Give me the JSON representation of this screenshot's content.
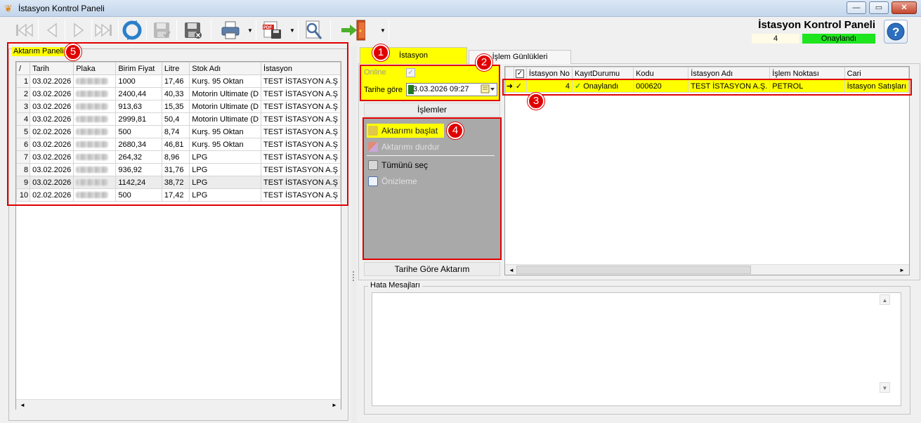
{
  "window": {
    "title": "İstasyon Kontrol Paneli",
    "buttons": {
      "minimize": "—",
      "maximize": "▭",
      "close": "✕"
    }
  },
  "header": {
    "title": "İstasyon Kontrol Paneli",
    "count": "4",
    "status": "Onaylandı",
    "status_color": "#1ee51e"
  },
  "toolbar": {
    "icons": [
      "first-record-icon",
      "previous-record-icon",
      "next-record-icon",
      "last-record-icon",
      "refresh-icon",
      "save-icon",
      "cancel-save-icon",
      "print-icon",
      "export-pdf-icon",
      "tools-icon",
      "exit-icon"
    ],
    "dropdown_glyph": "▼"
  },
  "left_panel": {
    "legend": "Aktarım Paneli",
    "columns": [
      "/",
      "Tarih",
      "Plaka",
      "Birim Fiyat",
      "Litre",
      "Stok Adı",
      "İstasyon"
    ],
    "rows": [
      {
        "no": "1",
        "tarih": "03.02.2026",
        "birim_fiyat": "1000",
        "litre": "17,46",
        "stok": "Kurş. 95 Oktan",
        "istasyon": "TEST İSTASYON A.Ş"
      },
      {
        "no": "2",
        "tarih": "03.02.2026",
        "birim_fiyat": "2400,44",
        "litre": "40,33",
        "stok": "Motorin Ultimate (D",
        "istasyon": "TEST İSTASYON A.Ş"
      },
      {
        "no": "3",
        "tarih": "03.02.2026",
        "birim_fiyat": "913,63",
        "litre": "15,35",
        "stok": "Motorin Ultimate (D",
        "istasyon": "TEST İSTASYON A.Ş"
      },
      {
        "no": "4",
        "tarih": "03.02.2026",
        "birim_fiyat": "2999,81",
        "litre": "50,4",
        "stok": "Motorin Ultimate (D",
        "istasyon": "TEST İSTASYON A.Ş"
      },
      {
        "no": "5",
        "tarih": "02.02.2026",
        "birim_fiyat": "500",
        "litre": "8,74",
        "stok": "Kurş. 95 Oktan",
        "istasyon": "TEST İSTASYON A.Ş"
      },
      {
        "no": "6",
        "tarih": "03.02.2026",
        "birim_fiyat": "2680,34",
        "litre": "46,81",
        "stok": "Kurş. 95 Oktan",
        "istasyon": "TEST İSTASYON A.Ş"
      },
      {
        "no": "7",
        "tarih": "03.02.2026",
        "birim_fiyat": "264,32",
        "litre": "8,96",
        "stok": "LPG",
        "istasyon": "TEST İSTASYON A.Ş"
      },
      {
        "no": "8",
        "tarih": "03.02.2026",
        "birim_fiyat": "936,92",
        "litre": "31,76",
        "stok": "LPG",
        "istasyon": "TEST İSTASYON A.Ş"
      },
      {
        "no": "9",
        "tarih": "03.02.2026",
        "birim_fiyat": "1142,24",
        "litre": "38,72",
        "stok": "LPG",
        "istasyon": "TEST İSTASYON A.Ş"
      },
      {
        "no": "10",
        "tarih": "02.02.2026",
        "birim_fiyat": "500",
        "litre": "17,42",
        "stok": "LPG",
        "istasyon": "TEST İSTASYON A.Ş"
      }
    ]
  },
  "tabs": [
    {
      "label": "İstasyon"
    },
    {
      "label": "İşlem Günlükleri"
    }
  ],
  "filters": {
    "online_label": "Online",
    "online_checked": "✓",
    "date_label": "Tarihe göre",
    "date_value": "3.03.2026 09:27"
  },
  "operations": {
    "title": "İşlemler",
    "items": [
      {
        "label": "Aktarımı başlat",
        "icon": "start-transfer-icon"
      },
      {
        "label": "Aktarımı durdur",
        "icon": "stop-transfer-icon"
      },
      {
        "label": "Tümünü seç",
        "icon": "select-all-icon"
      },
      {
        "label": "Önizleme",
        "icon": "preview-icon"
      }
    ],
    "footer": "Tarihe Göre Aktarım"
  },
  "right_grid": {
    "columns": [
      "",
      "✓",
      "İstasyon No",
      "KayıtDurumu",
      "Kodu",
      "İstasyon Adı",
      "İşlem Noktası",
      "Cari"
    ],
    "row": {
      "indicator": "➜",
      "checked": "✓",
      "istasyon_no": "4",
      "kayit_durumu": "Onaylandı",
      "kodu": "000620",
      "istasyon_adi": "TEST İSTASYON A.Ş.",
      "islem_noktasi": "PETROL",
      "cari": "İstasyon Satışları"
    }
  },
  "error_panel": {
    "legend": "Hata Mesajları"
  },
  "annotations": [
    "1",
    "2",
    "3",
    "4",
    "5"
  ],
  "annotation_color": "#e00000",
  "highlight_color": "#ffff00",
  "scroll": {
    "left": "◄",
    "right": "►",
    "up": "▲",
    "down": "▼"
  }
}
